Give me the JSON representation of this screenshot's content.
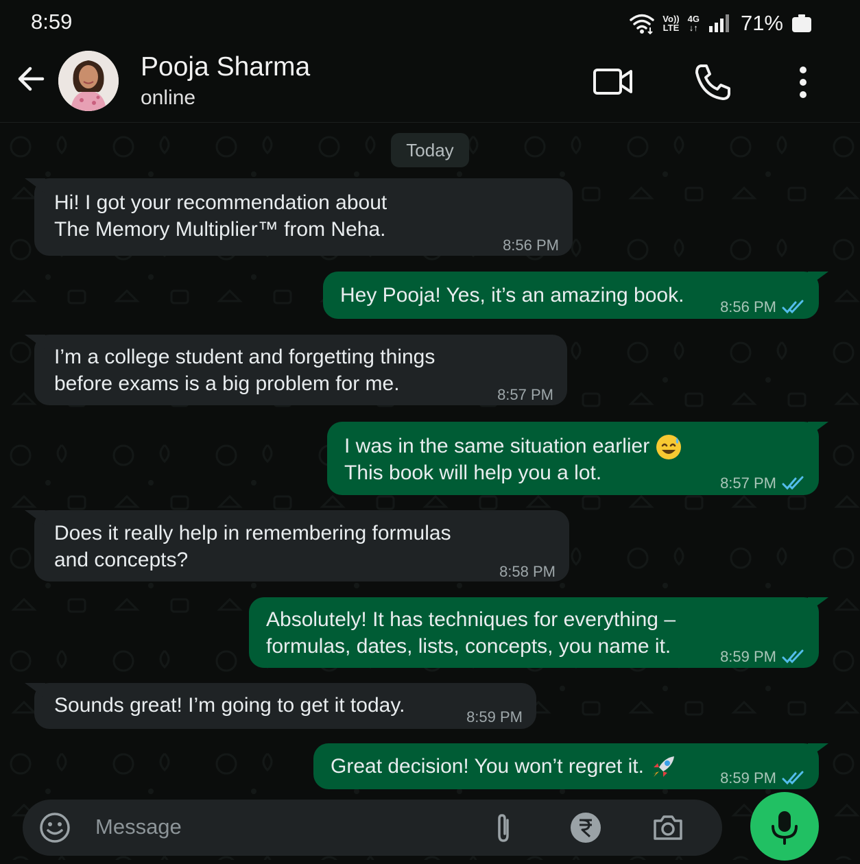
{
  "status_bar": {
    "time": "8:59",
    "volte_top": "Vo))",
    "volte_bottom": "LTE",
    "network": "4G",
    "battery": "71%"
  },
  "header": {
    "contact_name": "Pooja Sharma",
    "contact_status": "online",
    "icons": [
      "back-arrow-icon",
      "video-call-icon",
      "voice-call-icon",
      "more-options-icon"
    ]
  },
  "chat": {
    "day_label": "Today",
    "messages": [
      {
        "direction": "incoming",
        "line1": "Hi! I got your recommendation about",
        "line2": "The Memory Multiplier™ from Neha.",
        "time": "8:56 PM"
      },
      {
        "direction": "outgoing",
        "line1": "Hey Pooja! Yes, it’s an amazing book.",
        "time": "8:56 PM",
        "status": "read"
      },
      {
        "direction": "incoming",
        "line1": "I’m a college student and forgetting things",
        "line2": "before exams is a big problem for me.",
        "time": "8:57 PM"
      },
      {
        "direction": "outgoing",
        "line1": "I was in the same situation earlier",
        "line2": "This book will help you a lot.",
        "emoji": "sweat-smile-emoji",
        "time": "8:57 PM",
        "status": "read"
      },
      {
        "direction": "incoming",
        "line1": "Does it really help in remembering formulas",
        "line2": "and concepts?",
        "time": "8:58 PM"
      },
      {
        "direction": "outgoing",
        "line1": "Absolutely! It has techniques for everything –",
        "line2": "formulas, dates, lists, concepts, you name it.",
        "time": "8:59 PM",
        "status": "read"
      },
      {
        "direction": "incoming",
        "line1": "Sounds great! I’m going to get it today.",
        "time": "8:59 PM"
      },
      {
        "direction": "outgoing",
        "line1": "Great decision! You won’t regret it.",
        "emoji": "rocket-emoji",
        "time": "8:59 PM",
        "status": "read"
      }
    ]
  },
  "composer": {
    "placeholder": "Message",
    "icons": [
      "emoji-icon",
      "attach-icon",
      "rupee-payment-icon",
      "camera-icon",
      "mic-icon"
    ]
  },
  "colors": {
    "background": "#0b0d0c",
    "incoming_bubble": "#1f2325",
    "outgoing_bubble": "#005c35",
    "read_ticks": "#53bdeb",
    "mic_button": "#21c063"
  }
}
